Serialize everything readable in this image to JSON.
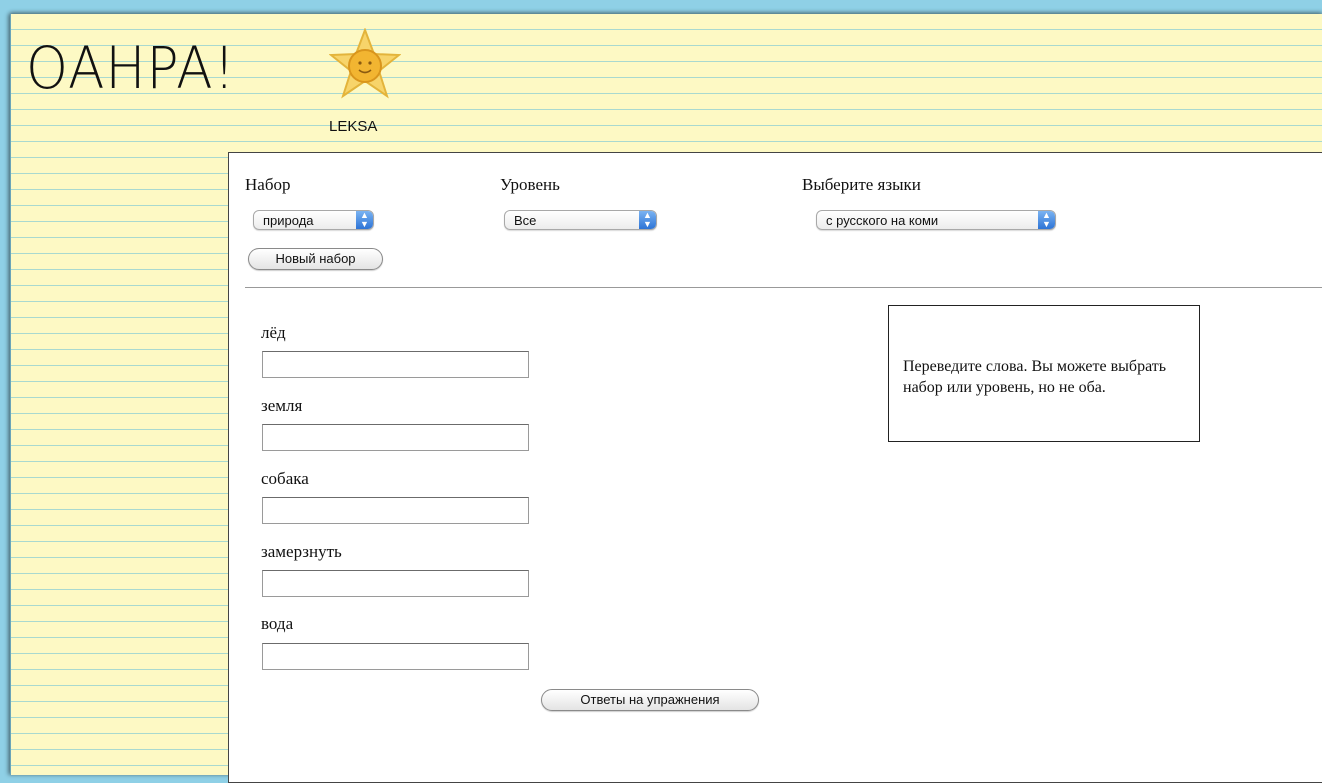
{
  "header": {
    "logo_text": "OAHPA!",
    "subtitle": "LEKSA"
  },
  "controls": {
    "set_label": "Набор",
    "set_value": "природа",
    "level_label": "Уровень",
    "level_value": "Все",
    "language_label": "Выберите языки",
    "language_value": "с русского на коми",
    "new_set_button": "Новый набор"
  },
  "exercise": {
    "words": [
      {
        "word": "лёд",
        "answer": ""
      },
      {
        "word": "земля",
        "answer": ""
      },
      {
        "word": "собака",
        "answer": ""
      },
      {
        "word": "замерзнуть",
        "answer": ""
      },
      {
        "word": "вода",
        "answer": ""
      }
    ],
    "answers_button": "Ответы на упражнения"
  },
  "info": {
    "text": "Переведите слова. Вы можете выбрать набор или уровень, но не оба."
  },
  "colors": {
    "paper": "#fdf9c4",
    "ruled_line": "#a9d9cf",
    "page_background": "#8fd0e6",
    "select_arrow": "#2e74d6"
  },
  "icons": {
    "logo_mascot": "sun-star-icon",
    "select_arrow": "updown-arrows-icon"
  }
}
